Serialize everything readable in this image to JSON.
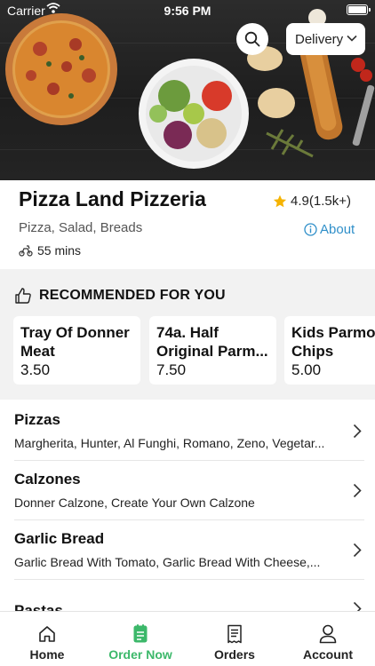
{
  "status_bar": {
    "carrier": "Carrier",
    "time": "9:56 PM"
  },
  "header": {
    "delivery_label": "Delivery"
  },
  "restaurant": {
    "name": "Pizza Land Pizzeria",
    "rating": "4.9(1.5k+)",
    "cuisine": "Pizza, Salad, Breads",
    "about_label": "About",
    "eta": "55 mins"
  },
  "recommended": {
    "heading": "RECOMMENDED FOR YOU",
    "items": [
      {
        "name": "Tray Of Donner Meat",
        "price": "3.50"
      },
      {
        "name": "74a. Half Original Parm...",
        "price": "7.50"
      },
      {
        "name": "Kids Parmo With Chips",
        "price": "5.00"
      }
    ]
  },
  "categories": [
    {
      "name": "Pizzas",
      "items": "Margherita, Hunter, Al Funghi, Romano, Zeno, Vegetar..."
    },
    {
      "name": "Calzones",
      "items": "Donner Calzone, Create Your Own Calzone"
    },
    {
      "name": "Garlic Bread",
      "items": "Garlic Bread With Tomato, Garlic Bread With Cheese,..."
    },
    {
      "name": "Pastas",
      "items": ""
    }
  ],
  "tabbar": {
    "items": [
      {
        "label": "Home",
        "icon": "home-icon"
      },
      {
        "label": "Order Now",
        "icon": "order-icon"
      },
      {
        "label": "Orders",
        "icon": "receipt-icon"
      },
      {
        "label": "Account",
        "icon": "user-icon"
      }
    ],
    "active_color": "#3cb86a"
  },
  "colors": {
    "accent": "#3cb86a",
    "link": "#2f8fc9",
    "star": "#f5b301"
  }
}
